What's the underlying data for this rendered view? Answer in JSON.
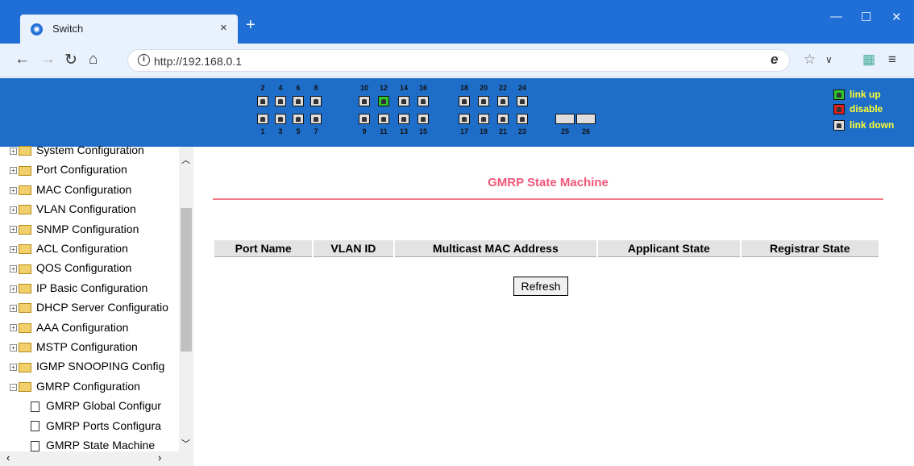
{
  "browser": {
    "tab_title": "Switch",
    "url": "http://192.168.0.1",
    "new_tab": "+",
    "tab_close": "×"
  },
  "switch_panel": {
    "top_port_labels": [
      "2",
      "4",
      "6",
      "8",
      "10",
      "12",
      "14",
      "16",
      "18",
      "20",
      "22",
      "24"
    ],
    "bottom_port_labels": [
      "1",
      "3",
      "5",
      "7",
      "9",
      "11",
      "13",
      "15",
      "17",
      "19",
      "21",
      "23"
    ],
    "sfp_labels": [
      "25",
      "26"
    ],
    "linked_up_ports": [
      "12"
    ],
    "legend": {
      "link_up": "link up",
      "disable": "disable",
      "link_down": "link down"
    },
    "colors": {
      "link_up": "#2ec82e",
      "disable": "#e02020",
      "link_down": "#dddddd",
      "legend_text": "#ffff33"
    }
  },
  "sidebar": {
    "items": [
      {
        "label": "System Configuration",
        "type": "folder"
      },
      {
        "label": "Port Configuration",
        "type": "folder"
      },
      {
        "label": "MAC Configuration",
        "type": "folder"
      },
      {
        "label": "VLAN Configuration",
        "type": "folder"
      },
      {
        "label": "SNMP Configuration",
        "type": "folder"
      },
      {
        "label": "ACL Configuration",
        "type": "folder"
      },
      {
        "label": "QOS Configuration",
        "type": "folder"
      },
      {
        "label": "IP Basic Configuration",
        "type": "folder"
      },
      {
        "label": "DHCP Server Configuratio",
        "type": "folder"
      },
      {
        "label": "AAA Configuration",
        "type": "folder"
      },
      {
        "label": "MSTP Configuration",
        "type": "folder"
      },
      {
        "label": "IGMP SNOOPING Config",
        "type": "folder"
      },
      {
        "label": "GMRP Configuration",
        "type": "folder-open"
      },
      {
        "label": "GMRP Global Configur",
        "type": "page"
      },
      {
        "label": "GMRP Ports Configura",
        "type": "page"
      },
      {
        "label": "GMRP State Machine",
        "type": "page"
      }
    ]
  },
  "main": {
    "title": "GMRP State Machine",
    "columns": [
      "Port Name",
      "VLAN ID",
      "Multicast MAC Address",
      "Applicant State",
      "Registrar State"
    ],
    "refresh_label": "Refresh",
    "title_color": "#f0577a"
  }
}
